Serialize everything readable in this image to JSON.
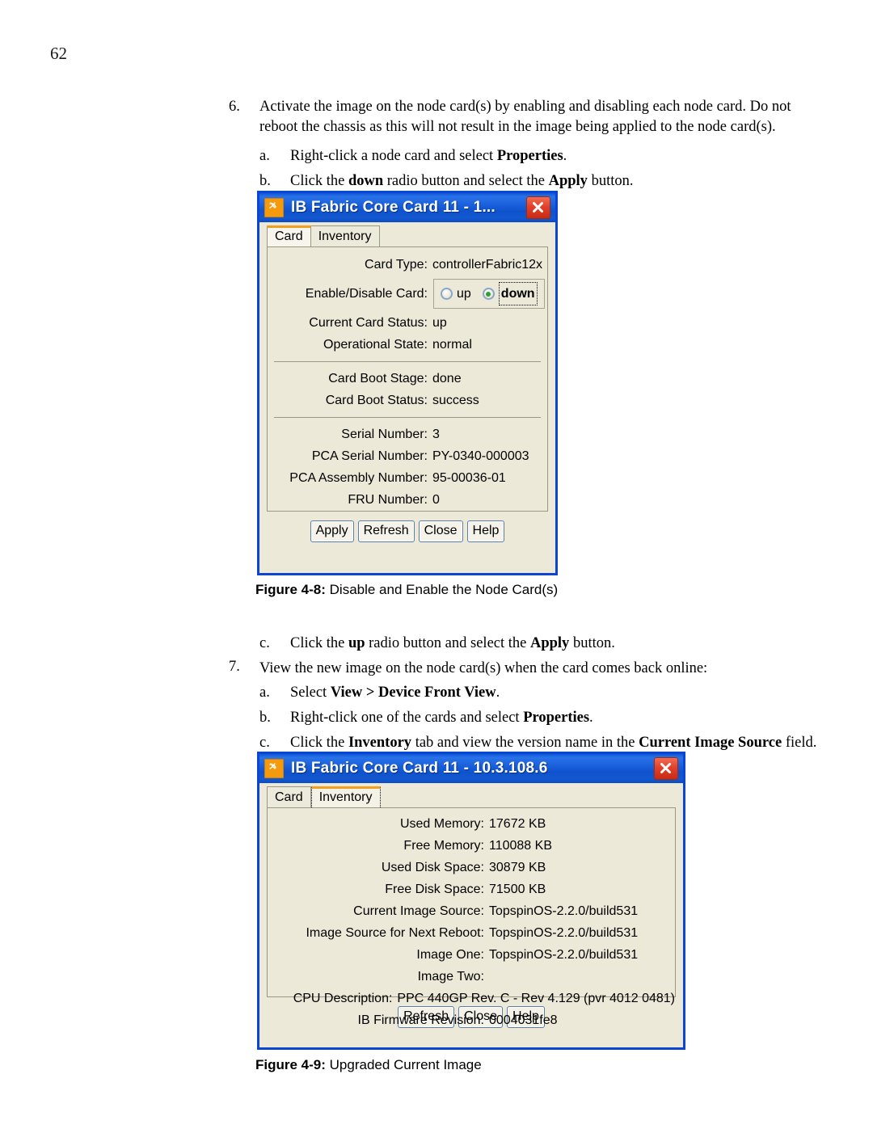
{
  "page": {
    "number": "62"
  },
  "doc": {
    "step6": {
      "marker": "6.",
      "text_line1": "Activate the image on the node card(s) by enabling and disabling each node card. Do not reboot the",
      "text_line2": "chassis as this will not result in the image being applied to the node card(s)."
    },
    "step6a": {
      "marker": "a.",
      "pre": "Right-click a node card and select ",
      "bold": "Properties",
      "post": "."
    },
    "step6b": {
      "marker": "b.",
      "pre": "Click the ",
      "bold1": "down",
      "mid": " radio button and select the ",
      "bold2": "Apply",
      "post": " button."
    },
    "step6c": {
      "marker": "c.",
      "pre": "Click the ",
      "bold1": "up",
      "mid": " radio button and select the ",
      "bold2": "Apply",
      "post": " button."
    },
    "step7": {
      "marker": "7.",
      "text": "View the new image on the node card(s) when the card comes back online:"
    },
    "step7a": {
      "marker": "a.",
      "pre": "Select ",
      "bold1": "View",
      "mid": " > ",
      "bold2": "Device Front View",
      "post": "."
    },
    "step7b": {
      "marker": "b.",
      "pre": "Right-click one of the cards and select ",
      "bold": "Properties",
      "post": "."
    },
    "step7c": {
      "marker": "c.",
      "pre": "Click the ",
      "bold1": "Inventory",
      "mid": " tab and view the version name in the ",
      "bold2": "Current Image Source",
      "post": " field."
    }
  },
  "figure48": {
    "caption_label": "Figure 4-8:",
    "caption_text": "Disable and Enable the Node Card(s)",
    "window": {
      "title": "IB Fabric Core Card 11 - 1...",
      "icon": "app-logo-icon",
      "close_icon": "close-icon",
      "tabs": [
        {
          "label": "Card",
          "state": "active"
        },
        {
          "label": "Inventory",
          "state": "inactive"
        }
      ],
      "group1": [
        {
          "label": "Card Type:",
          "value": "controllerFabric12x"
        }
      ],
      "radio_row": {
        "label": "Enable/Disable Card:",
        "options": [
          {
            "label": "up",
            "checked": false
          },
          {
            "label": "down",
            "checked": true
          }
        ]
      },
      "group2": [
        {
          "label": "Current Card Status:",
          "value": "up"
        },
        {
          "label": "Operational State:",
          "value": "normal"
        }
      ],
      "group3": [
        {
          "label": "Card Boot Stage:",
          "value": "done"
        },
        {
          "label": "Card Boot Status:",
          "value": "success"
        }
      ],
      "group4": [
        {
          "label": "Serial Number:",
          "value": "3"
        },
        {
          "label": "PCA Serial Number:",
          "value": "PY-0340-000003"
        },
        {
          "label": "PCA Assembly Number:",
          "value": "95-00036-01"
        },
        {
          "label": "FRU Number:",
          "value": "0"
        }
      ],
      "buttons": [
        "Apply",
        "Refresh",
        "Close",
        "Help"
      ]
    }
  },
  "figure49": {
    "caption_label": "Figure 4-9:",
    "caption_text": "Upgraded Current Image",
    "window": {
      "title": "IB Fabric Core Card 11 - 10.3.108.6",
      "icon": "app-logo-icon",
      "close_icon": "close-icon",
      "tabs": [
        {
          "label": "Card",
          "state": "inactive"
        },
        {
          "label": "Inventory",
          "state": "active"
        }
      ],
      "rows": [
        {
          "label": "Used Memory:",
          "value": "17672 KB"
        },
        {
          "label": "Free Memory:",
          "value": "110088 KB"
        },
        {
          "label": "Used Disk Space:",
          "value": "30879 KB"
        },
        {
          "label": "Free Disk Space:",
          "value": "71500 KB"
        },
        {
          "label": "Current Image Source:",
          "value": "TopspinOS-2.2.0/build531"
        },
        {
          "label": "Image Source for Next Reboot:",
          "value": "TopspinOS-2.2.0/build531"
        },
        {
          "label": "Image One:",
          "value": "TopspinOS-2.2.0/build531"
        },
        {
          "label": "Image Two:",
          "value": ""
        },
        {
          "label": "CPU Description:",
          "value": "PPC 440GP Rev. C - Rev 4.129 (pvr 4012 0481)"
        },
        {
          "label": "IB Firmware Revision:",
          "value": "0004031fe8"
        }
      ],
      "buttons": [
        "Refresh",
        "Close",
        "Help"
      ]
    }
  },
  "colors": {
    "titlebar_blue": "#1358cf",
    "window_border": "#0a46d2",
    "panel_face": "#ece9d8",
    "tab_accent_orange": "#f0a020",
    "close_red": "#c72a12",
    "radio_green": "#2fa02f"
  }
}
